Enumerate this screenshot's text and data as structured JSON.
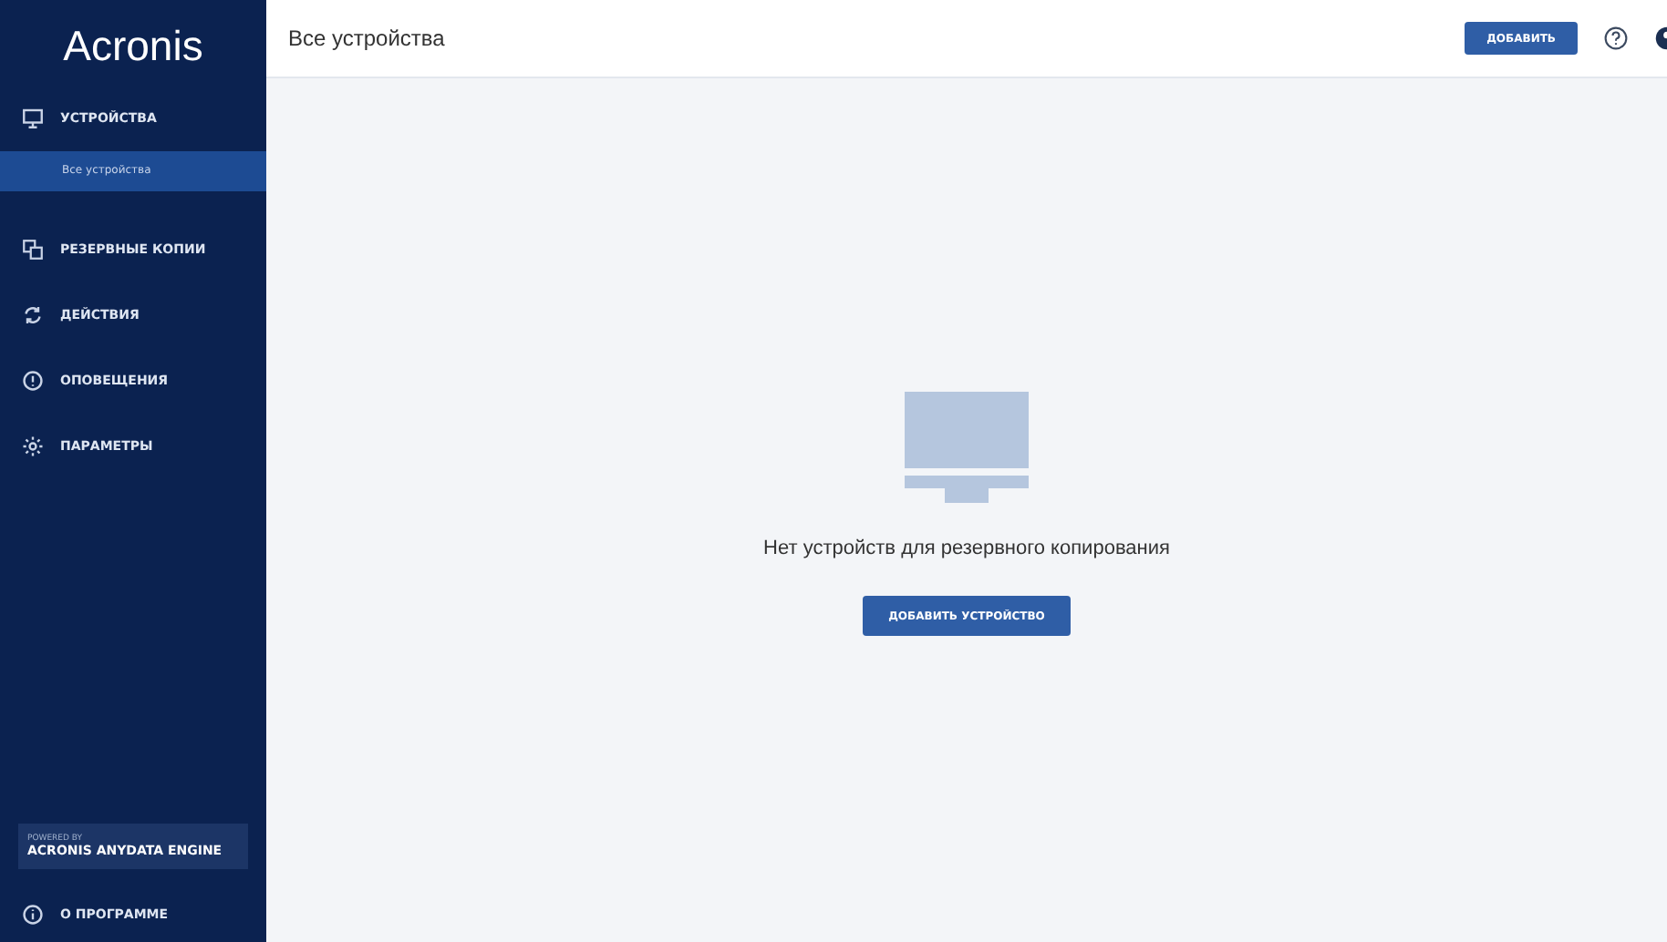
{
  "sidebar": {
    "logo": "Acronis",
    "items": [
      {
        "label": "УСТРОЙСТВА",
        "selected": false,
        "children": [
          {
            "label": "Все устройства",
            "selected": true
          }
        ]
      },
      {
        "label": "РЕЗЕРВНЫЕ КОПИИ",
        "selected": false
      },
      {
        "label": "ДЕЙСТВИЯ",
        "selected": false
      },
      {
        "label": "ОПОВЕЩЕНИЯ",
        "selected": false
      },
      {
        "label": "ПАРАМЕТРЫ",
        "selected": false
      }
    ],
    "badge": {
      "small": "POWERED BY",
      "big": "ACRONIS ANYDATA ENGINE"
    },
    "about": "О ПРОГРАММЕ"
  },
  "header": {
    "title": "Все устройства",
    "add_button": "ДОБАВИТЬ"
  },
  "empty_state": {
    "message": "Нет устройств для резервного копирования",
    "button": "ДОБАВИТЬ УСТРОЙСТВО"
  }
}
